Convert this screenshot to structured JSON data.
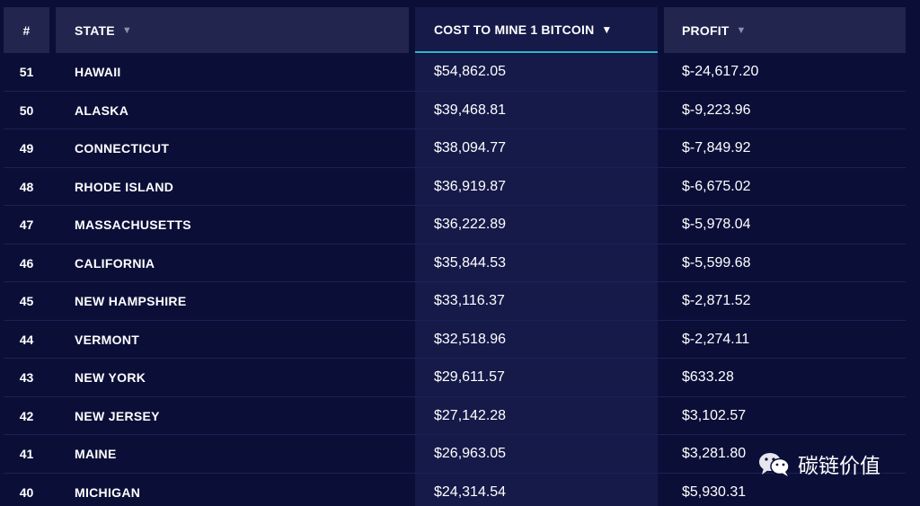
{
  "headers": {
    "rank": "#",
    "state": "STATE",
    "cost": "COST TO MINE 1 BITCOIN",
    "profit": "PROFIT",
    "sort_arrow": "▼"
  },
  "rows": [
    {
      "rank": "51",
      "state": "HAWAII",
      "cost": "$54,862.05",
      "profit": "$-24,617.20"
    },
    {
      "rank": "50",
      "state": "ALASKA",
      "cost": "$39,468.81",
      "profit": "$-9,223.96"
    },
    {
      "rank": "49",
      "state": "CONNECTICUT",
      "cost": "$38,094.77",
      "profit": "$-7,849.92"
    },
    {
      "rank": "48",
      "state": "RHODE ISLAND",
      "cost": "$36,919.87",
      "profit": "$-6,675.02"
    },
    {
      "rank": "47",
      "state": "MASSACHUSETTS",
      "cost": "$36,222.89",
      "profit": "$-5,978.04"
    },
    {
      "rank": "46",
      "state": "CALIFORNIA",
      "cost": "$35,844.53",
      "profit": "$-5,599.68"
    },
    {
      "rank": "45",
      "state": "NEW HAMPSHIRE",
      "cost": "$33,116.37",
      "profit": "$-2,871.52"
    },
    {
      "rank": "44",
      "state": "VERMONT",
      "cost": "$32,518.96",
      "profit": "$-2,274.11"
    },
    {
      "rank": "43",
      "state": "NEW YORK",
      "cost": "$29,611.57",
      "profit": "$633.28"
    },
    {
      "rank": "42",
      "state": "NEW JERSEY",
      "cost": "$27,142.28",
      "profit": "$3,102.57"
    },
    {
      "rank": "41",
      "state": "MAINE",
      "cost": "$26,963.05",
      "profit": "$3,281.80"
    },
    {
      "rank": "40",
      "state": "MICHIGAN",
      "cost": "$24,314.54",
      "profit": "$5,930.31"
    }
  ],
  "watermark": {
    "icon": "wechat-icon",
    "text": "碳链价值"
  },
  "colors": {
    "background": "#0b0f38",
    "header": "#22264f",
    "sorted_column": "#161a49",
    "sort_underline": "#2fb5cf"
  }
}
